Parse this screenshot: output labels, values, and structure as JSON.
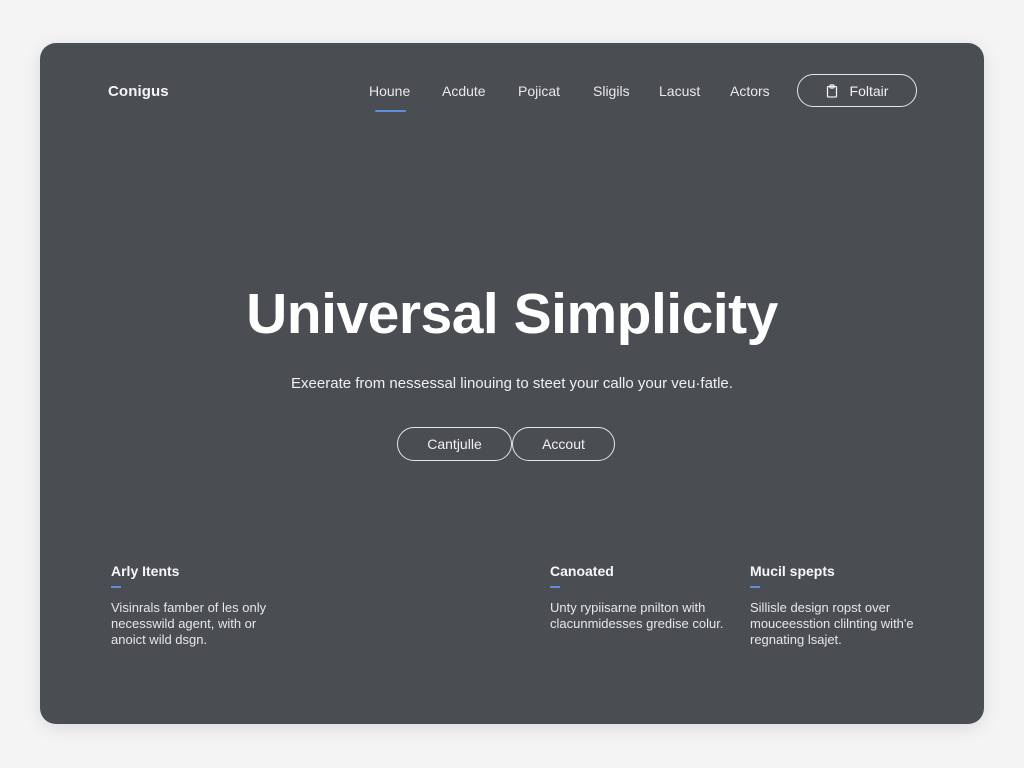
{
  "brand": "Conigus",
  "nav": {
    "items": [
      {
        "label": "Houne",
        "active": true
      },
      {
        "label": "Acdute",
        "active": false
      },
      {
        "label": "Pojicat",
        "active": false
      },
      {
        "label": "Sligils",
        "active": false
      },
      {
        "label": "Lacust",
        "active": false
      },
      {
        "label": "Actors",
        "active": false
      }
    ],
    "cta": {
      "label": "Foltair",
      "icon": "clipboard-icon"
    }
  },
  "hero": {
    "title": "Universal Simplicity",
    "subtitle": "Exeerate from nessessal linouing to steet your callo your veu·fatle.",
    "buttons": [
      {
        "label": "Cantjulle"
      },
      {
        "label": "Accout"
      }
    ]
  },
  "features": [
    {
      "title": "Arly Itents",
      "desc": "Visinrals famber of les only necesswild agent, with or anoict wild dsgn."
    },
    {
      "title": "Canoated",
      "desc": "Unty rypiisarne pnilton with clacunmidesses gredise colur."
    },
    {
      "title": "Mucil spepts",
      "desc": "Sillisle design ropst over mouceesstion clilnting with'e regnating lsajet."
    }
  ],
  "colors": {
    "background": "#4a4d52",
    "page": "#f4f4f5",
    "accent": "#5b8fd8",
    "text": "#ffffff"
  }
}
